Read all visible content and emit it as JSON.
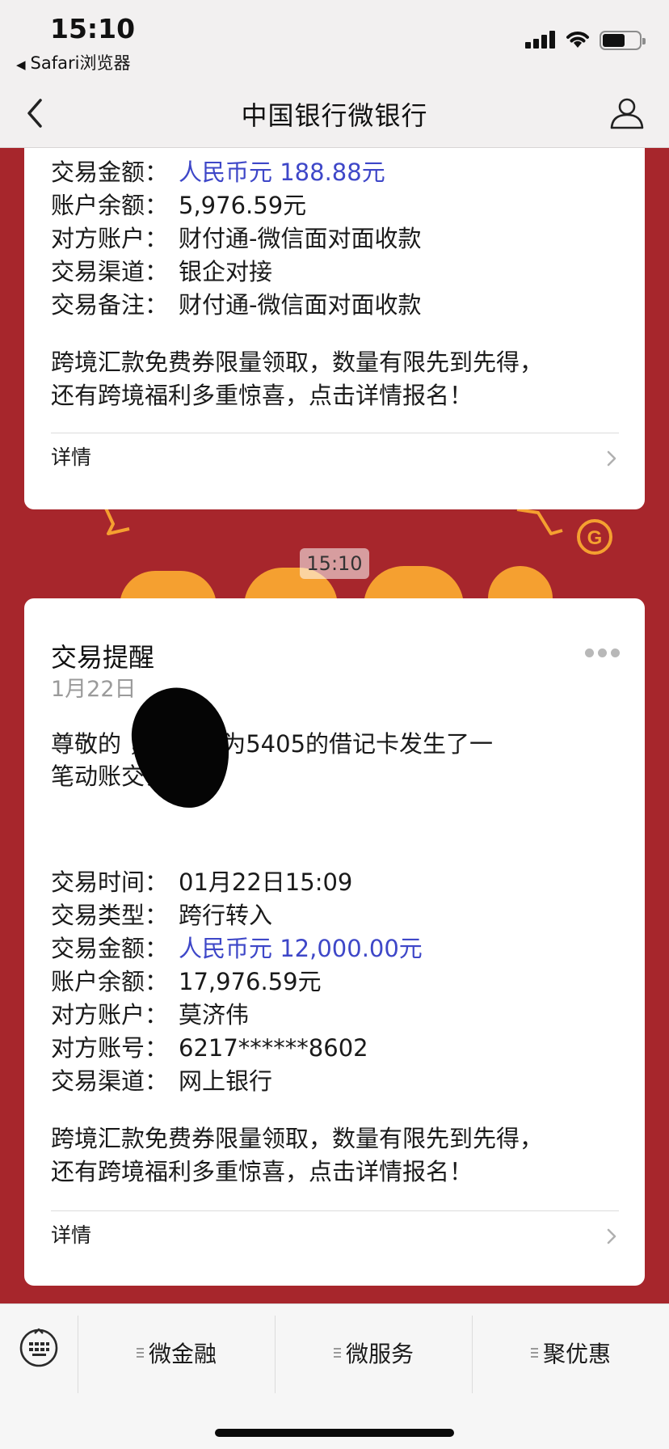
{
  "status_bar": {
    "time": "15:10",
    "back_app": "Safari浏览器"
  },
  "nav": {
    "title": "中国银行微银行"
  },
  "message_1": {
    "rows": [
      {
        "label": "交易金额：",
        "value": "人民币元 188.88元"
      },
      {
        "label": "账户余额：",
        "value": "5,976.59元"
      },
      {
        "label": "对方账户：",
        "value": "财付通-微信面对面收款"
      },
      {
        "label": "交易渠道：",
        "value": "银企对接"
      },
      {
        "label": "交易备注：",
        "value": "财付通-微信面对面收款"
      }
    ],
    "promo_line1": "跨境汇款免费券限量领取，数量有限先到先得，",
    "promo_line2": "还有跨境福利多重惊喜，点击详情报名！",
    "detail_label": "详情"
  },
  "timestamp": "15:10",
  "message_2": {
    "title": "交易提醒",
    "date": "1月22日",
    "greeting_line1": "尊敬的         ，您尾号为5405的借记卡发生了一",
    "greeting_line2": "笔动账交易",
    "rows": [
      {
        "label": "交易时间：",
        "value": "01月22日15:09"
      },
      {
        "label": "交易类型：",
        "value": "跨行转入"
      },
      {
        "label": "交易金额：",
        "value": "人民币元 12,000.00元"
      },
      {
        "label": "账户余额：",
        "value": "17,976.59元"
      },
      {
        "label": "对方账户：",
        "value": "莫济伟"
      },
      {
        "label": "对方账号：",
        "value": "6217******8602"
      },
      {
        "label": "交易渠道：",
        "value": "网上银行"
      }
    ],
    "promo_line1": "跨境汇款免费券限量领取，数量有限先到先得，",
    "promo_line2": "还有跨境福利多重惊喜，点击详情报名！",
    "detail_label": "详情"
  },
  "bottom_menu": {
    "items": [
      {
        "label": "微金融"
      },
      {
        "label": "微服务"
      },
      {
        "label": "聚优惠"
      }
    ]
  },
  "colors": {
    "background_red": "#a7262c",
    "amount_blue": "#3e47c8",
    "decoration_orange": "#f5a030"
  },
  "icons": [
    "back-chevron-icon",
    "user-icon",
    "more-dots-icon",
    "chevron-right-icon",
    "keyboard-icon",
    "menu-lines-icon"
  ]
}
